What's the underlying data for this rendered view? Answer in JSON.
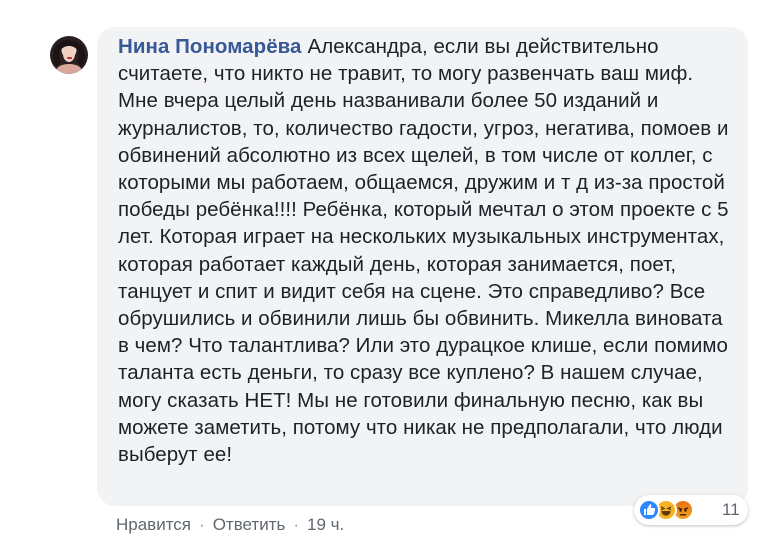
{
  "comment": {
    "author": "Нина Пономарёва",
    "text": "Александра, если вы действительно считаете, что никто не травит, то могу развенчать ваш миф. Мне вчера целый день названивали более 50 изданий и журналистов, то, количество гадости, угроз, негатива, помоев и обвинений абсолютно из всех щелей, в том числе от коллег, с которыми мы работаем, общаемся, дружим и т д из-за простой победы ребёнка!!!! Ребёнка, который мечтал о этом проекте с 5 лет. Которая играет на нескольких музыкальных инструментах, которая работает каждый день, которая занимается, поет, танцует и спит и видит себя на сцене. Это справедливо? Все обрушились и обвинили лишь бы обвинить. Микелла виновата в чем? Что талантлива? Или это дурацкое клише, если помимо таланта есть деньги, то сразу все куплено? В нашем случае, могу сказать НЕТ! Мы не готовили финальную песню, как вы можете заметить, потому что никак не предполагали, что люди выберут ее!",
    "reactions": {
      "icons": [
        "like-icon",
        "haha-icon",
        "angry-icon"
      ],
      "count": "11"
    },
    "actions": {
      "like": "Нравится",
      "reply": "Ответить",
      "separator": "·",
      "time": "19 ч."
    }
  },
  "colors": {
    "author": "#385898",
    "bubble": "#f2f3f5",
    "text": "#1d2129",
    "meta": "#616770",
    "like": "#2d88ff",
    "haha": "#f7b125",
    "angry": "#e9710f"
  }
}
